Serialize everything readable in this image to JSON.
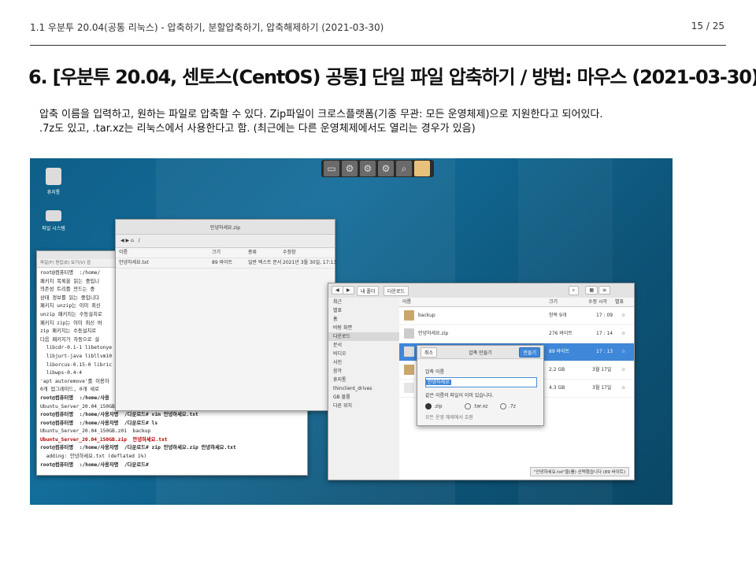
{
  "header": {
    "breadcrumb": "1.1 우분투 20.04(공통 리눅스) - 압축하기, 분할압축하기, 압축해제하기 (2021-03-30)",
    "page": "15 / 25"
  },
  "title": "6. [우분투 20.04, 센토스(CentOS) 공통] 단일 파일 압축하기 / 방법: 마우스 (2021-03-30)",
  "body": {
    "line1": "압축 이름을 입력하고, 원하는 파일로 압축할 수 있다. Zip파일이 크로스플랫폼(기종 무관: 모든 운영체제)으로 지원한다고 되어있다.",
    "line2": ".7z도 있고, .tar.xz는 리눅스에서 사용한다고 함. (최근에는 다른 운영체제에서도 열리는 경우가 있음)"
  },
  "screenshot": {
    "desktop_icons": [
      {
        "label": "휴지통"
      },
      {
        "label": "파일 시스템"
      }
    ],
    "archive_window": {
      "title": "안녕하세요.zip",
      "path": "/",
      "columns": [
        "이름",
        "크기",
        "종류",
        "수정함"
      ],
      "row": {
        "name": "안녕하세요.txt",
        "size": "89 바이트",
        "type": "일반 텍스트 문서",
        "modified": "2021년 3월 30일, 17:13"
      }
    },
    "terminal": {
      "menu": "파일(F)  편집(E)  보기(V)  검",
      "lines": [
        "root@컴퓨터명  :/home/",
        "패키지 목록을 읽는 중입니",
        "의존성 트리를 만드는 중",
        "상태 정보를 읽는 중입니다",
        "패키지 unzip는 이미 최신",
        "unzip 패키지는 수동설치로",
        "패키지 zip는 이미 최신 버",
        "zip 패키지는 수동설치로",
        "다음 패키지가 자동으로 설",
        "  libcdr-0.1-1 libetonye",
        "  libjurt-java libllvm10",
        "  liborcus-0.15-0 libric",
        "  libwps-0.4-4",
        "'apt autoremove'를 이용하",
        "0개 업그레이드, 0개 새로",
        "root@컴퓨터명  :/home/사용",
        "Ubuntu_Server_20.04_150GB.",
        "root@컴퓨터명  :/home/사용자명  /다운로드# vim 안녕하세요.txt",
        "root@컴퓨터명  :/home/사용자명  /다운로드# ls",
        "Ubuntu_Server_20.04_150GB.z01  backup",
        "Ubuntu_Server_20.04_150GB.zip  안녕하세요.txt",
        "root@컴퓨터명  :/home/사용자명  /다운로드# zip 안녕하세요.zip 안녕하세요.txt",
        "  adding: 안녕하세요.txt (deflated 1%)",
        "root@컴퓨터명  :/home/사용자명  /다운로드# "
      ]
    },
    "file_manager": {
      "breadcrumb": [
        "내 폴더",
        "다운로드"
      ],
      "sidebar": [
        "최근",
        "별표",
        "홈",
        "바탕 화면",
        "다운로드",
        "문서",
        "비디오",
        "사진",
        "음악",
        "휴지통",
        "thinclient_drives",
        "GB 볼륨",
        "다른 위치"
      ],
      "columns": [
        "이름",
        "크기",
        "수정 시각",
        "별표"
      ],
      "rows": [
        {
          "name": "backup",
          "size": "항목 9개",
          "time": "17 : 09"
        },
        {
          "name": "안녕하세요.zip",
          "size": "276 바이트",
          "time": "17 : 14"
        },
        {
          "name": "",
          "size": "89 바이트",
          "time": "17 : 13"
        },
        {
          "name": "",
          "size": "2.2 GB",
          "time": "3월 17일"
        },
        {
          "name": "",
          "size": "4.3 GB",
          "time": "3월 17일"
        }
      ],
      "status": "\"안녕하세요.txt\"을(를) 선택했습니다 (89 바이트)"
    },
    "dialog": {
      "cancel": "취소",
      "title": "압축 만들기",
      "create": "만들기",
      "label": "압축 이름",
      "value": "안녕하세요",
      "warning": "같은 이름의 파일이 이미 있습니다.",
      "options": [
        ".zip",
        ".tar.xz",
        ".7z"
      ],
      "hint": "모든 운영 체제에서 호환"
    }
  }
}
